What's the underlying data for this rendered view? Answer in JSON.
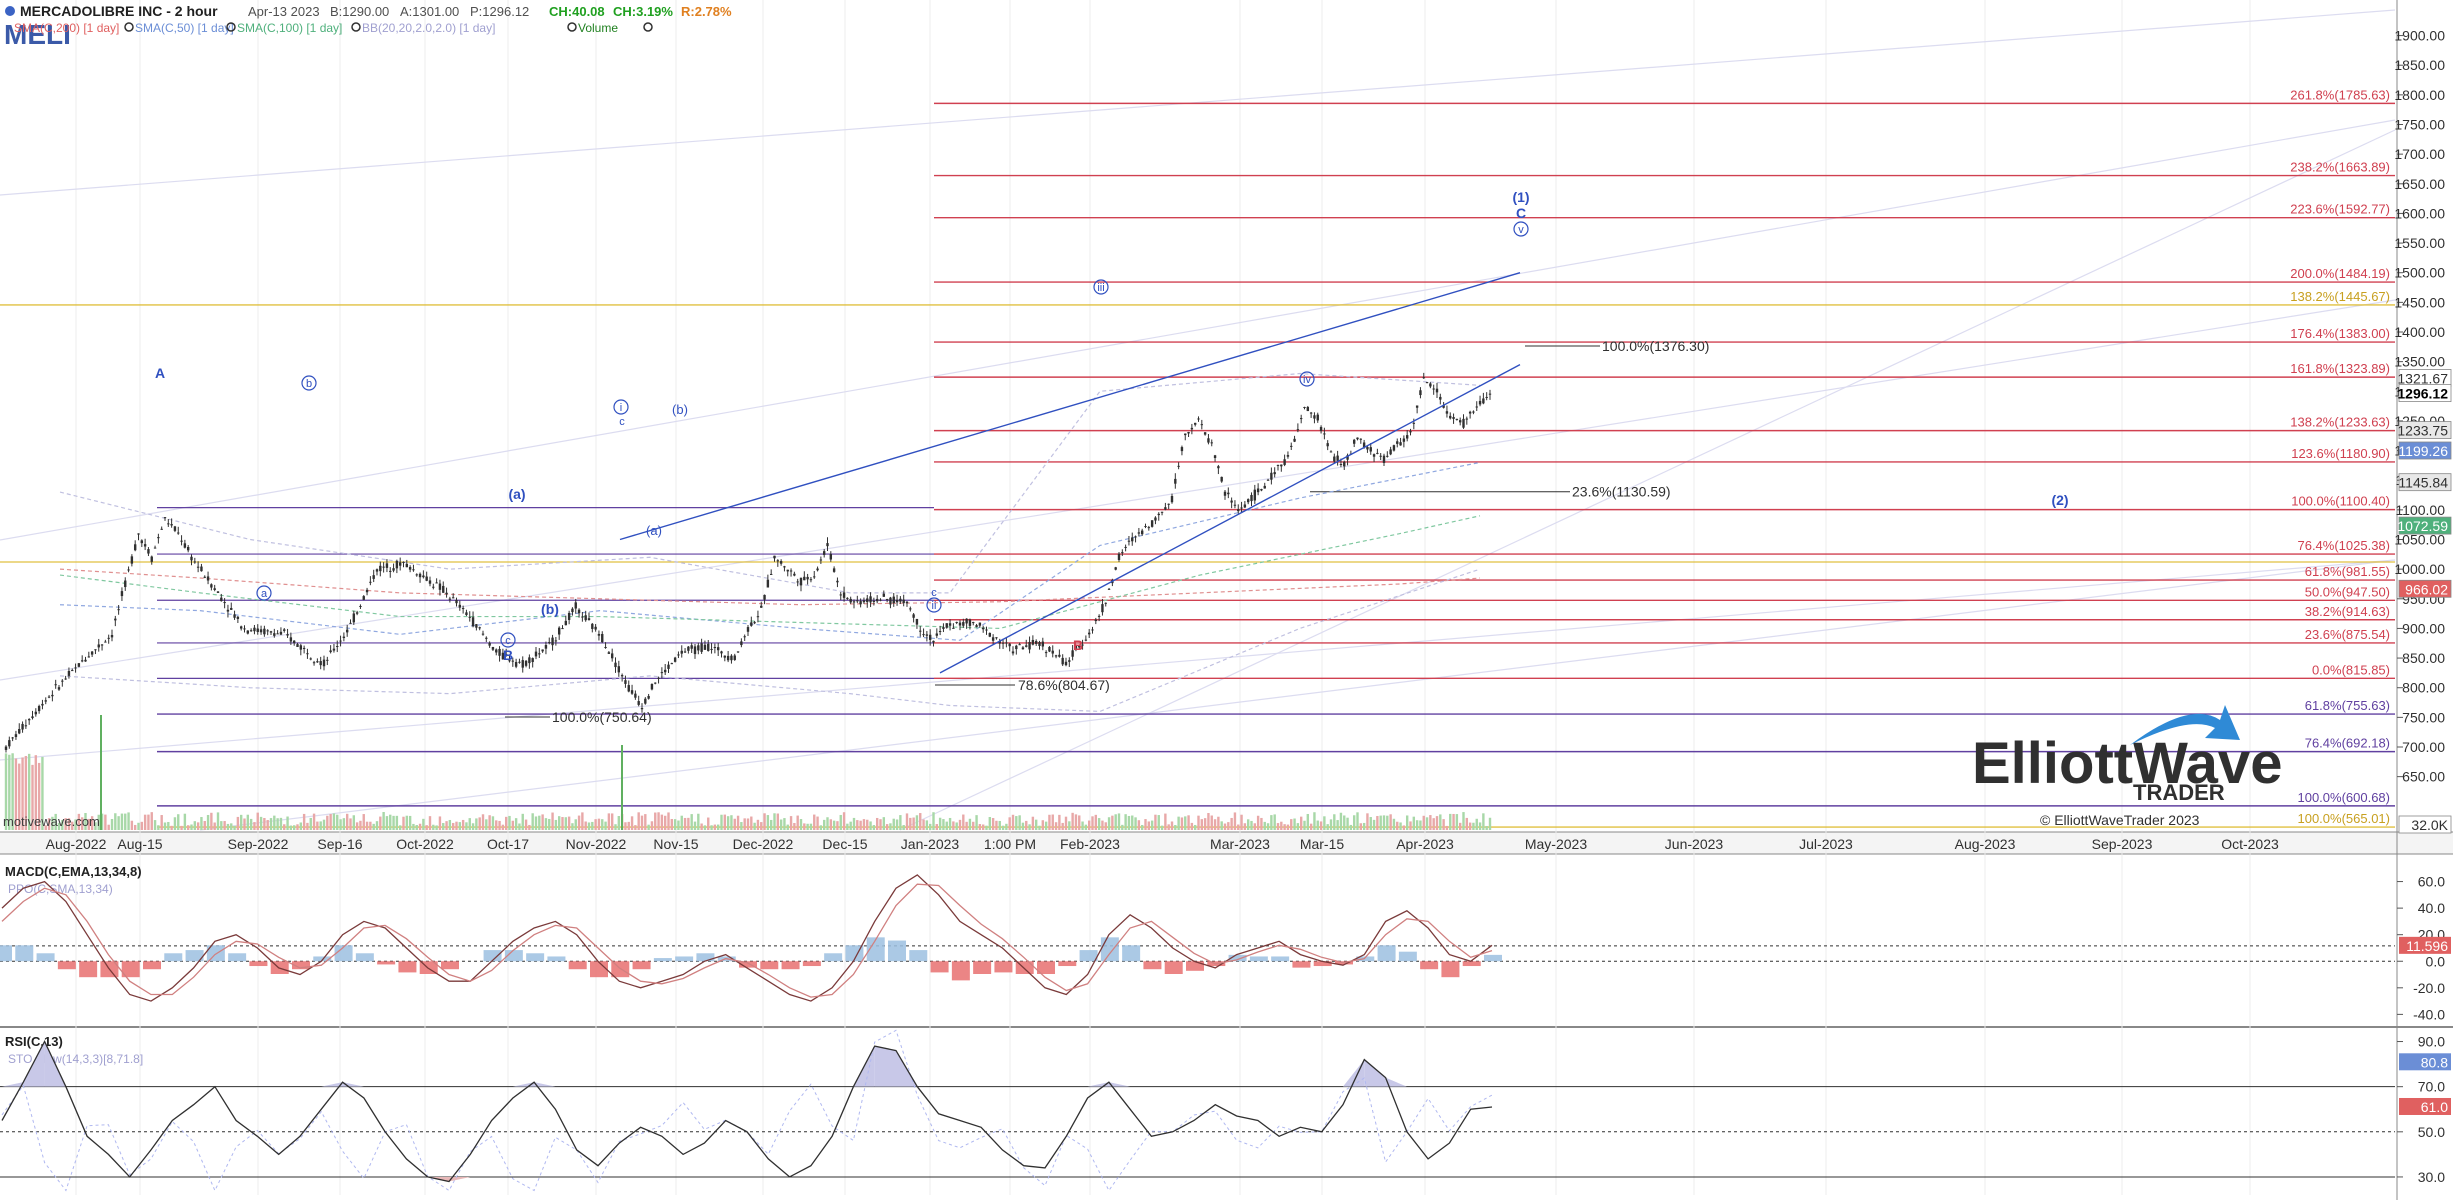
{
  "header": {
    "title": "MERCADOLIBRE INC - 2 hour",
    "date": "Apr-13 2023",
    "bid": "B:1290.00",
    "ask": "A:1301.00",
    "price": "P:1296.12",
    "change": "CH:40.08",
    "change_pct": "CH:3.19%",
    "range": "R:2.78%",
    "symbol": "MELI",
    "indicators": [
      {
        "label": "SMA(C,200) [1 day]",
        "color": "#e06060"
      },
      {
        "label": "SMA(C,50) [1 day]",
        "color": "#6b8ed6"
      },
      {
        "label": "SMA(C,100) [1 day]",
        "color": "#4fb07c"
      },
      {
        "label": "BB(20,20,2.0,2.0) [1 day]",
        "color": "#a0a0d0"
      },
      {
        "label": "Volume",
        "color": "#208020"
      }
    ]
  },
  "watermark": "motivewave.com",
  "logo": {
    "line1": "ElliottWave",
    "line2": "TRADER",
    "copyright": "© ElliottWaveTrader 2023"
  },
  "colors": {
    "red_fib": "#d04050",
    "purple_fib": "#6040a0",
    "gold": "#e0c040",
    "blue": "#3050c0",
    "candle": "#303030"
  },
  "chart_data": [
    {
      "type": "candlestick",
      "title": "MERCADOLIBRE INC - 2 hour",
      "ylim": [
        560,
        1960
      ],
      "y_ticks": [
        650,
        700,
        750,
        800,
        850,
        900,
        950,
        1000,
        1050,
        1100,
        1150,
        1200,
        1250,
        1300,
        1350,
        1400,
        1450,
        1500,
        1550,
        1600,
        1650,
        1700,
        1750,
        1800,
        1850,
        1900
      ],
      "x_labels": [
        "Aug-2022",
        "Aug-15",
        "Sep-2022",
        "Sep-16",
        "Oct-2022",
        "Oct-17",
        "Nov-2022",
        "Nov-15",
        "Dec-2022",
        "Dec-15",
        "Jan-2023",
        "1:00 PM",
        "Feb-2023",
        "Mar-2023",
        "Mar-15",
        "Apr-2023",
        "May-2023",
        "Jun-2023",
        "Jul-2023",
        "Aug-2023",
        "Sep-2023",
        "Oct-2023"
      ],
      "price_path": [
        [
          0,
          700
        ],
        [
          3,
          780
        ],
        [
          6,
          850
        ],
        [
          8,
          890
        ],
        [
          10,
          1060
        ],
        [
          11,
          1020
        ],
        [
          12,
          1085
        ],
        [
          13,
          1060
        ],
        [
          14,
          1020
        ],
        [
          16,
          960
        ],
        [
          18,
          900
        ],
        [
          21,
          890
        ],
        [
          24,
          840
        ],
        [
          26,
          905
        ],
        [
          28,
          1000
        ],
        [
          30,
          1010
        ],
        [
          33,
          965
        ],
        [
          35,
          920
        ],
        [
          37,
          860
        ],
        [
          39,
          840
        ],
        [
          41,
          870
        ],
        [
          43,
          935
        ],
        [
          45,
          885
        ],
        [
          47,
          800
        ],
        [
          48,
          770
        ],
        [
          49,
          810
        ],
        [
          51,
          860
        ],
        [
          53,
          870
        ],
        [
          55,
          850
        ],
        [
          56,
          900
        ],
        [
          57,
          930
        ],
        [
          58,
          1020
        ],
        [
          60,
          980
        ],
        [
          61,
          990
        ],
        [
          62,
          1040
        ],
        [
          63,
          960
        ],
        [
          64,
          945
        ],
        [
          66,
          950
        ],
        [
          68,
          945
        ],
        [
          69,
          900
        ],
        [
          70,
          880
        ],
        [
          71,
          905
        ],
        [
          73,
          910
        ],
        [
          75,
          880
        ],
        [
          76,
          865
        ],
        [
          78,
          875
        ],
        [
          79,
          860
        ],
        [
          80,
          840
        ],
        [
          81,
          870
        ],
        [
          82,
          900
        ],
        [
          83,
          945
        ],
        [
          84,
          1020
        ],
        [
          85,
          1050
        ],
        [
          86,
          1070
        ],
        [
          87,
          1090
        ],
        [
          88,
          1120
        ],
        [
          89,
          1230
        ],
        [
          90,
          1250
        ],
        [
          91,
          1210
        ],
        [
          92,
          1130
        ],
        [
          93,
          1100
        ],
        [
          94,
          1120
        ],
        [
          95,
          1140
        ],
        [
          96,
          1170
        ],
        [
          97,
          1200
        ],
        [
          98,
          1270
        ],
        [
          99,
          1255
        ],
        [
          100,
          1195
        ],
        [
          101,
          1175
        ],
        [
          102,
          1220
        ],
        [
          103,
          1200
        ],
        [
          104,
          1185
        ],
        [
          105,
          1210
        ],
        [
          106,
          1230
        ],
        [
          107,
          1320
        ],
        [
          108,
          1300
        ],
        [
          109,
          1255
        ],
        [
          110,
          1245
        ],
        [
          111,
          1275
        ],
        [
          112,
          1296
        ]
      ],
      "fib_levels_red": [
        {
          "label": "261.8%(1785.63)",
          "value": 1785.63
        },
        {
          "label": "238.2%(1663.89)",
          "value": 1663.89
        },
        {
          "label": "223.6%(1592.77)",
          "value": 1592.77
        },
        {
          "label": "200.0%(1484.19)",
          "value": 1484.19
        },
        {
          "label": "176.4%(1383.00)",
          "value": 1383.0
        },
        {
          "label": "161.8%(1323.89)",
          "value": 1323.89
        },
        {
          "label": "138.2%(1233.63)",
          "value": 1233.63
        },
        {
          "label": "123.6%(1180.90)",
          "value": 1180.9
        },
        {
          "label": "100.0%(1100.40)",
          "value": 1100.4
        },
        {
          "label": "76.4%(1025.38)",
          "value": 1025.38
        },
        {
          "label": "61.8%(981.55)",
          "value": 981.55
        },
        {
          "label": "50.0%(947.50)",
          "value": 947.5
        },
        {
          "label": "38.2%(914.63)",
          "value": 914.63
        },
        {
          "label": "23.6%(875.54)",
          "value": 875.54
        },
        {
          "label": "0.0%(815.85)",
          "value": 815.85
        }
      ],
      "fib_levels_purple": [
        {
          "label": "61.8%(755.63)",
          "value": 755.63
        },
        {
          "label": "76.4%(692.18)",
          "value": 692.18
        },
        {
          "label": "100.0%(600.68)",
          "value": 600.68
        }
      ],
      "fib_levels_gold": [
        {
          "label": "138.2%(1445.67)",
          "value": 1445.67
        },
        {
          "label": "100.0%(565.01)",
          "value": 565.01
        }
      ],
      "local_fibs": [
        {
          "label": "100.0%(1376.30)",
          "value": 1376.3
        },
        {
          "label": "23.6%(1130.59)",
          "value": 1130.59
        },
        {
          "label": "78.6%(804.67)",
          "value": 804.67
        },
        {
          "label": "100.0%(750.64)",
          "value": 750.64
        }
      ],
      "price_badges": [
        {
          "label": "1321.67",
          "value": 1321.67,
          "bg": "#ffffff",
          "fg": "#303030"
        },
        {
          "label": "1296.12",
          "value": 1296.12,
          "bg": "#ffffff",
          "fg": "#000000"
        },
        {
          "label": "1233.75",
          "value": 1233.75,
          "bg": "#e8e8e8",
          "fg": "#303030"
        },
        {
          "label": "1199.26",
          "value": 1199.26,
          "bg": "#6b8ed6",
          "fg": "#ffffff"
        },
        {
          "label": "1145.84",
          "value": 1145.84,
          "bg": "#e8e8e8",
          "fg": "#303030"
        },
        {
          "label": "1072.59",
          "value": 1072.59,
          "bg": "#4fb07c",
          "fg": "#ffffff"
        },
        {
          "label": "966.02",
          "value": 966.02,
          "bg": "#e06060",
          "fg": "#ffffff"
        },
        {
          "label": "32.0K",
          "value": 560,
          "bg": "#ffffff",
          "fg": "#303030"
        }
      ],
      "wave_labels": [
        {
          "text": "A",
          "color": "#3050c0",
          "style": "plain"
        },
        {
          "text": "B",
          "color": "#3050c0",
          "style": "plain"
        },
        {
          "text": "B",
          "color": "#d04050",
          "style": "plain"
        },
        {
          "text": "C",
          "color": "#3050c0",
          "style": "plain"
        },
        {
          "text": "(1)",
          "color": "#3050c0",
          "style": "plain"
        },
        {
          "text": "(2)",
          "color": "#3050c0",
          "style": "plain"
        },
        {
          "text": "iii",
          "color": "#3050c0",
          "style": "circle"
        },
        {
          "text": "iv",
          "color": "#3050c0",
          "style": "circle"
        },
        {
          "text": "v",
          "color": "#3050c0",
          "style": "circle"
        },
        {
          "text": "ii",
          "color": "#3050c0",
          "style": "circle"
        },
        {
          "text": "i",
          "color": "#3050c0",
          "style": "circle"
        },
        {
          "text": "a",
          "color": "#3050c0",
          "style": "circle"
        },
        {
          "text": "b",
          "color": "#3050c0",
          "style": "circle"
        },
        {
          "text": "c",
          "color": "#3050c0",
          "style": "circle"
        },
        {
          "text": "(a)",
          "color": "#3050c0",
          "style": "plain"
        },
        {
          "text": "(b)",
          "color": "#3050c0",
          "style": "plain"
        }
      ]
    },
    {
      "type": "line",
      "title": "MACD(C,EMA,13,34,8)",
      "sub_label": "PPO(C,SMA,13,34)",
      "ylim": [
        -48,
        80
      ],
      "y_ticks": [
        -40,
        -20,
        0,
        20,
        40,
        60
      ],
      "tick_labels": [
        "-40.0",
        "-20.0",
        "0.0",
        "20.0",
        "40.0",
        "60.0"
      ],
      "current": "11.596",
      "series": [
        {
          "name": "MACD",
          "values": [
            40,
            55,
            60,
            45,
            20,
            -5,
            -25,
            -30,
            -20,
            -5,
            15,
            20,
            10,
            -5,
            -10,
            0,
            20,
            30,
            25,
            10,
            -5,
            -15,
            -15,
            0,
            15,
            25,
            30,
            20,
            0,
            -15,
            -20,
            -15,
            -10,
            0,
            5,
            -5,
            -15,
            -25,
            -30,
            -20,
            0,
            30,
            55,
            65,
            50,
            30,
            20,
            10,
            -5,
            -20,
            -25,
            -10,
            20,
            35,
            25,
            10,
            0,
            -5,
            5,
            10,
            15,
            5,
            0,
            -3,
            5,
            30,
            38,
            25,
            5,
            0,
            12
          ]
        },
        {
          "name": "Signal",
          "values": [
            30,
            45,
            55,
            50,
            30,
            5,
            -15,
            -25,
            -25,
            -12,
            5,
            15,
            13,
            3,
            -5,
            -3,
            10,
            25,
            27,
            17,
            3,
            -10,
            -15,
            -7,
            8,
            20,
            27,
            25,
            10,
            -5,
            -15,
            -17,
            -13,
            -5,
            2,
            -1,
            -10,
            -20,
            -27,
            -25,
            -10,
            15,
            42,
            58,
            57,
            42,
            28,
            17,
            3,
            -12,
            -22,
            -17,
            5,
            25,
            30,
            18,
            6,
            -2,
            1,
            7,
            12,
            9,
            3,
            -1,
            2,
            20,
            32,
            30,
            15,
            3,
            8
          ]
        }
      ]
    },
    {
      "type": "line",
      "title": "RSI(C,13)",
      "sub_label": "STO Slow(14,3,3)[8,71.8]",
      "ylim": [
        22,
        96
      ],
      "y_ticks": [
        30,
        50,
        70,
        90
      ],
      "tick_labels": [
        "30.0",
        "50.0",
        "70.0",
        "90.0"
      ],
      "levels": [
        70,
        50,
        30
      ],
      "badges": [
        {
          "label": "80.8",
          "value": 80.8,
          "bg": "#6b8ed6"
        },
        {
          "label": "61.0",
          "value": 61.0,
          "bg": "#e06060"
        }
      ],
      "series": [
        {
          "name": "RSI",
          "values": [
            55,
            72,
            90,
            70,
            48,
            40,
            30,
            42,
            55,
            62,
            70,
            55,
            48,
            40,
            48,
            60,
            72,
            65,
            50,
            38,
            30,
            28,
            40,
            55,
            65,
            72,
            60,
            42,
            35,
            45,
            52,
            48,
            40,
            45,
            55,
            50,
            38,
            30,
            35,
            48,
            70,
            88,
            86,
            70,
            58,
            55,
            52,
            42,
            35,
            34,
            48,
            65,
            72,
            60,
            48,
            50,
            55,
            62,
            57,
            55,
            48,
            52,
            50,
            62,
            82,
            74,
            50,
            38,
            45,
            60,
            61
          ]
        }
      ]
    }
  ]
}
